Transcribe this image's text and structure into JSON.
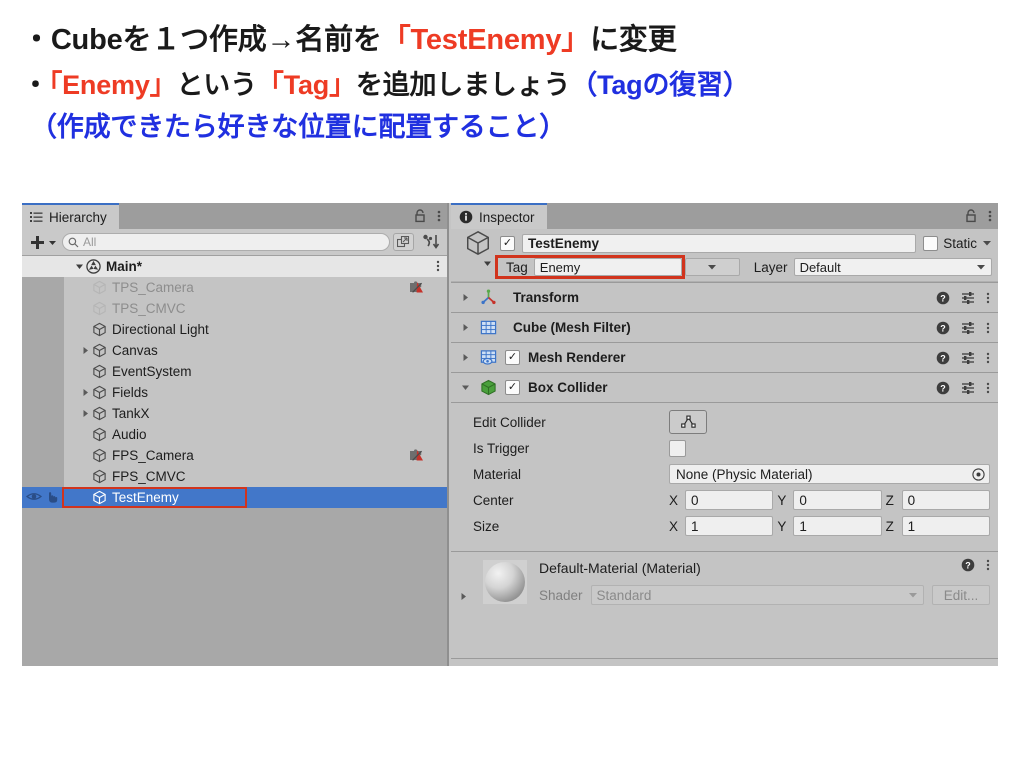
{
  "slide": {
    "line1": {
      "bullet": "・",
      "seg1": "Cubeを１つ作成→名前を",
      "seg2": "「TestEnemy」",
      "seg3": "に変更"
    },
    "line2": {
      "bullet": "・",
      "seg1": "「Enemy」",
      "seg2": "という",
      "seg3": "「Tag」",
      "seg4": "を追加しましょう",
      "seg5": "（Tagの復習）"
    },
    "line3": "（作成できたら好きな位置に配置すること）",
    "colors": {
      "red": "#ee3b24",
      "blue": "#2030e0",
      "black": "#1a1a1a"
    }
  },
  "hierarchy": {
    "tab_label": "Hierarchy",
    "tab_icon": "hierarchy-list-icon",
    "lock_icon": "lock-icon",
    "kebab_icon": "kebab-menu-icon",
    "add_label": "+",
    "search_placeholder": "All",
    "search_icon": "search-icon",
    "expand_icon": "expand-window-icon",
    "sort_icon": "sort-alpha-icon",
    "rows": [
      {
        "label": "Main*",
        "indent": 0,
        "twisty": "down",
        "icon": "unity-scene-icon",
        "state": "root",
        "prefab": false
      },
      {
        "label": "TPS_Camera",
        "indent": 1,
        "twisty": "none",
        "icon": "gameobject-cube-icon",
        "state": "disabled",
        "prefab": true
      },
      {
        "label": "TPS_CMVC",
        "indent": 1,
        "twisty": "none",
        "icon": "gameobject-cube-icon",
        "state": "disabled",
        "prefab": false
      },
      {
        "label": "Directional Light",
        "indent": 1,
        "twisty": "none",
        "icon": "gameobject-cube-icon",
        "state": "normal",
        "prefab": false
      },
      {
        "label": "Canvas",
        "indent": 1,
        "twisty": "right",
        "icon": "gameobject-cube-icon",
        "state": "normal",
        "prefab": false
      },
      {
        "label": "EventSystem",
        "indent": 1,
        "twisty": "none",
        "icon": "gameobject-cube-icon",
        "state": "normal",
        "prefab": false
      },
      {
        "label": "Fields",
        "indent": 1,
        "twisty": "right",
        "icon": "gameobject-cube-icon",
        "state": "normal",
        "prefab": false
      },
      {
        "label": "TankX",
        "indent": 1,
        "twisty": "right",
        "icon": "gameobject-cube-icon",
        "state": "normal",
        "prefab": false
      },
      {
        "label": "Audio",
        "indent": 1,
        "twisty": "none",
        "icon": "gameobject-cube-icon",
        "state": "normal",
        "prefab": false
      },
      {
        "label": "FPS_Camera",
        "indent": 1,
        "twisty": "none",
        "icon": "gameobject-cube-icon",
        "state": "normal",
        "prefab": true
      },
      {
        "label": "FPS_CMVC",
        "indent": 1,
        "twisty": "none",
        "icon": "gameobject-cube-icon",
        "state": "normal",
        "prefab": false
      },
      {
        "label": "TestEnemy",
        "indent": 1,
        "twisty": "none",
        "icon": "gameobject-cube-icon",
        "state": "selected",
        "prefab": false
      }
    ],
    "selected_highlight_color": "#d1341d",
    "selected_row_color": "#4277c9"
  },
  "inspector": {
    "tab_label": "Inspector",
    "tab_icon": "info-icon",
    "lock_icon": "lock-icon",
    "kebab_icon": "kebab-menu-icon",
    "gameobject_icon": "gameobject-cube-icon",
    "enabled_checked": true,
    "name_value": "TestEnemy",
    "static_label": "Static",
    "static_checked": false,
    "tag_label": "Tag",
    "tag_value": "Enemy",
    "tag_highlight_color": "#d1341d",
    "layer_label": "Layer",
    "layer_value": "Default",
    "components": [
      {
        "name": "Transform",
        "icon": "transform-axis-icon",
        "expanded": false,
        "has_toggle": false,
        "toggle_checked": false
      },
      {
        "name": "Cube (Mesh Filter)",
        "icon": "mesh-filter-grid-icon",
        "expanded": false,
        "has_toggle": false,
        "toggle_checked": false
      },
      {
        "name": "Mesh Renderer",
        "icon": "mesh-renderer-icon",
        "expanded": false,
        "has_toggle": true,
        "toggle_checked": true
      },
      {
        "name": "Box Collider",
        "icon": "box-collider-icon",
        "expanded": true,
        "has_toggle": true,
        "toggle_checked": true
      }
    ],
    "component_row_icons": {
      "help": "help-icon",
      "preset": "preset-sliders-icon",
      "kebab": "kebab-menu-icon"
    },
    "box_collider": {
      "edit_collider_label": "Edit Collider",
      "edit_collider_icon": "edit-collider-icon",
      "is_trigger_label": "Is Trigger",
      "is_trigger_checked": false,
      "material_label": "Material",
      "material_value": "None (Physic Material)",
      "material_picker_icon": "object-picker-icon",
      "center_label": "Center",
      "center": {
        "x_label": "X",
        "x": "0",
        "y_label": "Y",
        "y": "0",
        "z_label": "Z",
        "z": "0"
      },
      "size_label": "Size",
      "size": {
        "x_label": "X",
        "x": "1",
        "y_label": "Y",
        "y": "1",
        "z_label": "Z",
        "z": "1"
      }
    },
    "material_preview": {
      "title": "Default-Material (Material)",
      "preview_icon": "material-sphere-preview",
      "shader_label": "Shader",
      "shader_value": "Standard",
      "edit_label": "Edit...",
      "help_icon": "help-icon",
      "kebab_icon": "kebab-menu-icon",
      "expand_icon": "triangle-right-icon"
    }
  }
}
